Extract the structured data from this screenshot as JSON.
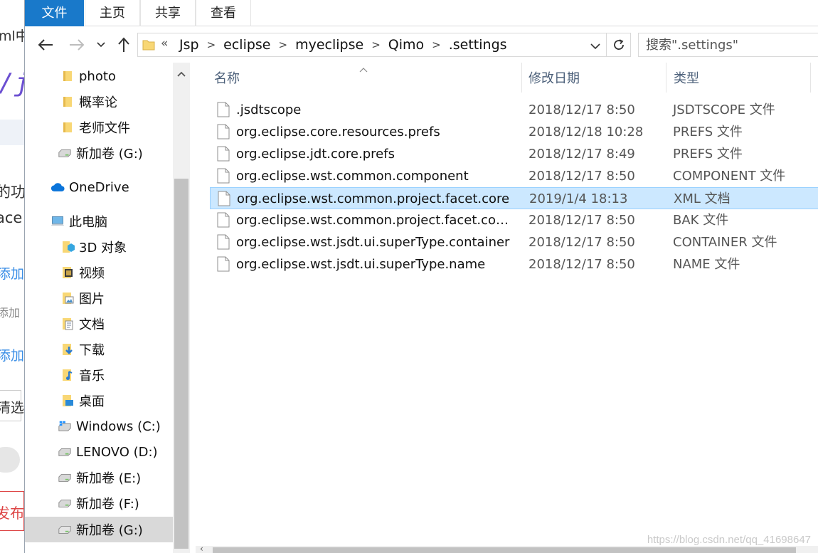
{
  "background_page": {
    "fragments": [
      "ml中",
      "/j",
      "的功",
      "ace",
      "添加",
      "添加",
      "添加",
      "清选",
      "发布t"
    ]
  },
  "ribbon": {
    "tabs": [
      "文件",
      "主页",
      "共享",
      "查看"
    ]
  },
  "address_bar": {
    "overflow_chevron": "«",
    "breadcrumbs": [
      "Jsp",
      "eclipse",
      "myeclipse",
      "Qimo",
      ".settings"
    ],
    "search_placeholder": "搜索\".settings\""
  },
  "nav_pane": {
    "items": [
      {
        "label": "photo",
        "icon": "folder-icon"
      },
      {
        "label": "概率论",
        "icon": "folder-icon"
      },
      {
        "label": "老师文件",
        "icon": "folder-icon"
      },
      {
        "label": "新加卷 (G:)",
        "icon": "drive-icon"
      },
      {
        "label": "OneDrive",
        "icon": "cloud-icon"
      },
      {
        "label": "此电脑",
        "icon": "computer-icon"
      },
      {
        "label": "3D 对象",
        "icon": "3d-objects-icon"
      },
      {
        "label": "视频",
        "icon": "video-folder-icon"
      },
      {
        "label": "图片",
        "icon": "pictures-folder-icon"
      },
      {
        "label": "文档",
        "icon": "documents-folder-icon"
      },
      {
        "label": "下载",
        "icon": "downloads-folder-icon"
      },
      {
        "label": "音乐",
        "icon": "music-folder-icon"
      },
      {
        "label": "桌面",
        "icon": "desktop-folder-icon"
      },
      {
        "label": "Windows (C:)",
        "icon": "windows-drive-icon"
      },
      {
        "label": "LENOVO (D:)",
        "icon": "drive-icon"
      },
      {
        "label": "新加卷 (E:)",
        "icon": "drive-icon"
      },
      {
        "label": "新加卷 (F:)",
        "icon": "drive-icon"
      },
      {
        "label": "新加卷 (G:)",
        "icon": "drive-icon"
      }
    ],
    "selected": "新加卷 (G:)"
  },
  "file_list": {
    "columns": {
      "name": "名称",
      "date": "修改日期",
      "type": "类型"
    },
    "sort_indicator": "ascending",
    "files": [
      {
        "name": ".jsdtscope",
        "date": "2018/12/17 8:50",
        "type": "JSDTSCOPE 文件",
        "selected": false
      },
      {
        "name": "org.eclipse.core.resources.prefs",
        "date": "2018/12/18 10:28",
        "type": "PREFS 文件",
        "selected": false
      },
      {
        "name": "org.eclipse.jdt.core.prefs",
        "date": "2018/12/17 8:49",
        "type": "PREFS 文件",
        "selected": false
      },
      {
        "name": "org.eclipse.wst.common.component",
        "date": "2018/12/17 8:50",
        "type": "COMPONENT 文件",
        "selected": false
      },
      {
        "name": "org.eclipse.wst.common.project.facet.core",
        "date": "2019/1/4 18:13",
        "type": "XML 文档",
        "selected": true
      },
      {
        "name": "org.eclipse.wst.common.project.facet.core.x...",
        "date": "2018/12/17 8:50",
        "type": "BAK 文件",
        "selected": false
      },
      {
        "name": "org.eclipse.wst.jsdt.ui.superType.container",
        "date": "2018/12/17 8:50",
        "type": "CONTAINER 文件",
        "selected": false
      },
      {
        "name": "org.eclipse.wst.jsdt.ui.superType.name",
        "date": "2018/12/17 8:50",
        "type": "NAME 文件",
        "selected": false
      }
    ]
  },
  "watermark": "https://blog.csdn.net/qq_41698647",
  "colors": {
    "file_tab": "#1979ca",
    "selection_bg": "#cce8ff",
    "selection_border": "#99d1ff",
    "folder": "#f8d775",
    "header_text": "#4c607a"
  }
}
